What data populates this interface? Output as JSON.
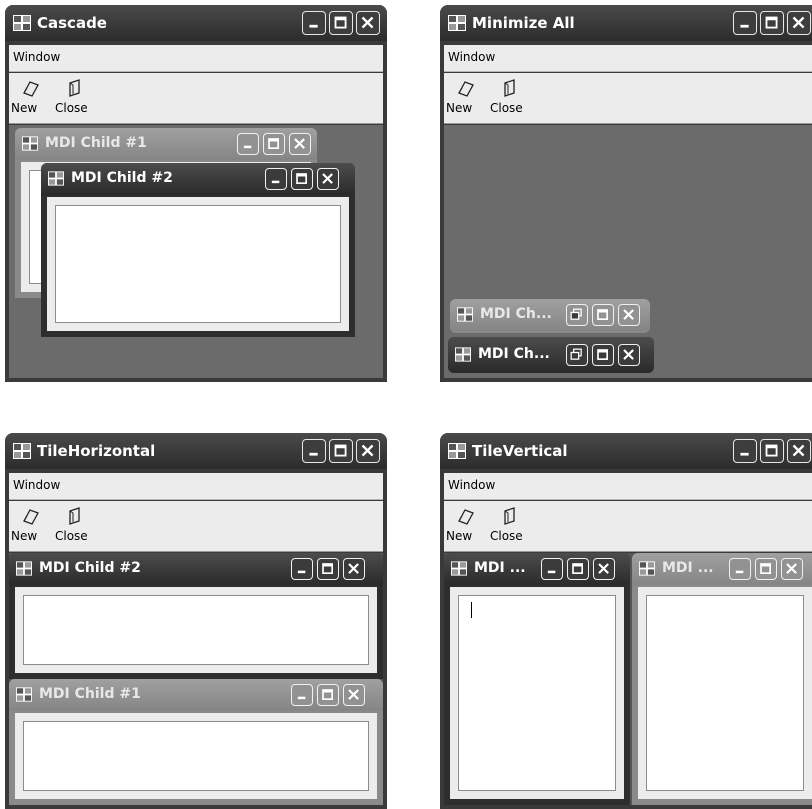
{
  "windows": [
    {
      "title": "Cascade",
      "menu": "Window",
      "toolbar": {
        "new": "New",
        "close": "Close"
      }
    },
    {
      "title": "Minimize All",
      "menu": "Window",
      "toolbar": {
        "new": "New",
        "close": "Close"
      }
    },
    {
      "title": "TileHorizontal",
      "menu": "Window",
      "toolbar": {
        "new": "New",
        "close": "Close"
      }
    },
    {
      "title": "TileVertical",
      "menu": "Window",
      "toolbar": {
        "new": "New",
        "close": "Close"
      }
    }
  ],
  "children": {
    "cascade": [
      "MDI Child #1",
      "MDI Child #2"
    ],
    "minimized": [
      "MDI Ch...",
      "MDI Ch..."
    ],
    "tile_horizontal": [
      "MDI Child #2",
      "MDI Child #1"
    ],
    "tile_vertical": [
      "MDI ...",
      "MDI ..."
    ]
  }
}
